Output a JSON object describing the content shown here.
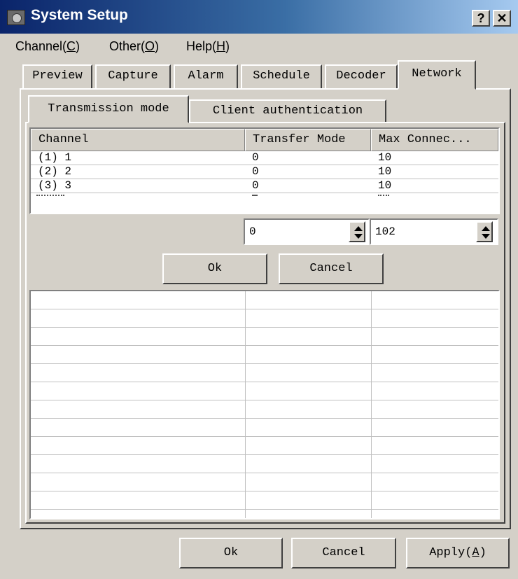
{
  "window": {
    "title": "System Setup",
    "help_glyph": "?",
    "close_glyph": "✕"
  },
  "menu": [
    {
      "pre": "Channel(",
      "key": "C",
      "post": ")"
    },
    {
      "pre": "Other(",
      "key": "O",
      "post": ")"
    },
    {
      "pre": "Help(",
      "key": "H",
      "post": ")"
    }
  ],
  "tabs": [
    "Preview",
    "Capture",
    "Alarm",
    "Schedule",
    "Decoder",
    "Network"
  ],
  "subtabs": [
    "Transmission mode",
    "Client authentication"
  ],
  "table": {
    "headers": [
      "Channel",
      "Transfer Mode",
      "Max Connec..."
    ],
    "rows": [
      [
        "(1) 1",
        "0",
        "10"
      ],
      [
        "(2) 2",
        "0",
        "10"
      ],
      [
        "(3) 3",
        "0",
        "10"
      ]
    ]
  },
  "editors": {
    "transfer_mode": "0",
    "max_connections": "102"
  },
  "inner_buttons": {
    "ok": "Ok",
    "cancel": "Cancel"
  },
  "footer": {
    "ok": "Ok",
    "cancel": "Cancel",
    "apply_pre": "Apply(",
    "apply_key": "A",
    "apply_post": ")"
  }
}
